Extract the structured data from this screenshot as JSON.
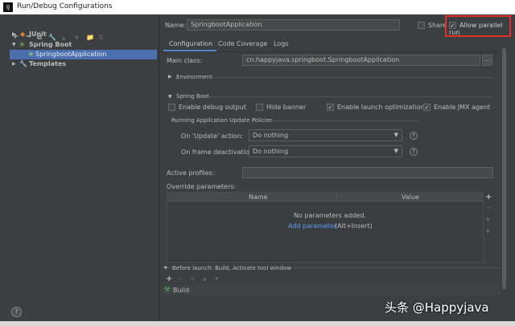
{
  "window": {
    "title": "Run/Debug Configurations",
    "logo": "IJ"
  },
  "toolbar": [
    "+",
    "−",
    "⧉",
    "🔧",
    "▲",
    "▼",
    "📁",
    "⇅"
  ],
  "tree": [
    {
      "label": "JUnit",
      "icon": "junit-icon"
    },
    {
      "label": "Spring Boot",
      "icon": "spring-boot-icon"
    },
    {
      "label": "SpringbootApplication",
      "icon": "spring-app-icon"
    },
    {
      "label": "Templates",
      "icon": "wrench-icon"
    }
  ],
  "name_label": "Name:",
  "name_value": "SpringbootApplication",
  "share_label": "Share",
  "allow_parallel_label": "Allow parallel run",
  "tabs": [
    "Configuration",
    "Code Coverage",
    "Logs"
  ],
  "main_class_label": "Main class:",
  "main_class_value": "cn.happyjava.springboot.SpringbootApplication",
  "browse": "...",
  "environment": "Environment",
  "spring_boot": "Spring Boot",
  "checks": [
    {
      "label": "Enable debug output",
      "checked": false
    },
    {
      "label": "Hide banner",
      "checked": false
    },
    {
      "label": "Enable launch optimization",
      "checked": true
    },
    {
      "label": "Enable JMX agent",
      "checked": true
    }
  ],
  "policies_title": "Running Application Update Policies",
  "on_update_label": "On 'Update' action:",
  "on_update_value": "Do nothing",
  "on_frame_label": "On frame deactivation:",
  "on_frame_value": "Do nothing",
  "help": "?",
  "active_profiles_label": "Active profiles:",
  "override_label": "Override parameters:",
  "table_headers": [
    "Name",
    "Value"
  ],
  "no_params": "No parameters added.",
  "add_param": "Add parameter",
  "add_param_hint": "(Alt+Insert)",
  "table_side": [
    "+",
    "−",
    "▲",
    "▼"
  ],
  "before_launch": "Before launch: Build, Activate tool window",
  "bl_toolbar": [
    "+",
    "−",
    "✎",
    "▲",
    "▼"
  ],
  "build": "Build",
  "watermark": "头条 @Happyjava",
  "colors": {
    "selection": "#4b6eaf",
    "highlight": "#e0302a",
    "link": "#589df6"
  }
}
